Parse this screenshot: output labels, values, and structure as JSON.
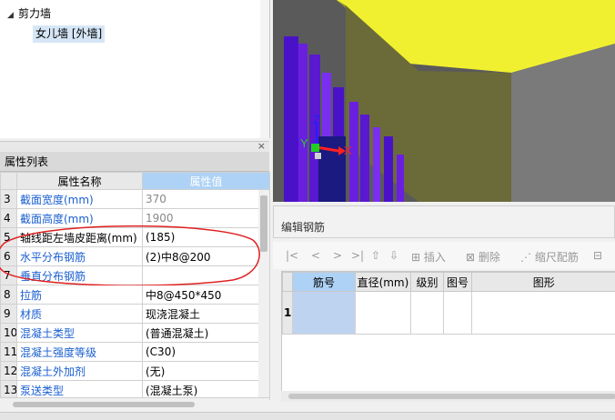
{
  "tree": {
    "group_label": "剪力墙",
    "item_label": "女儿墙 [外墙]"
  },
  "properties": {
    "panel_title": "属性列表",
    "col_name": "属性名称",
    "col_value": "属性值",
    "rows": [
      {
        "num": "3",
        "name": "截面宽度(mm)",
        "value": "370"
      },
      {
        "num": "4",
        "name": "截面高度(mm)",
        "value": "1900"
      },
      {
        "num": "5",
        "name": "轴线距左墙皮距离(mm)",
        "value": "(185)"
      },
      {
        "num": "6",
        "name": "水平分布钢筋",
        "value": "(2)中8@200"
      },
      {
        "num": "7",
        "name": "垂直分布钢筋",
        "value": ""
      },
      {
        "num": "8",
        "name": "拉筋",
        "value": "中8@450*450"
      },
      {
        "num": "9",
        "name": "材质",
        "value": "现浇混凝土"
      },
      {
        "num": "10",
        "name": "混凝土类型",
        "value": "(普通混凝土)"
      },
      {
        "num": "11",
        "name": "混凝土强度等级",
        "value": "(C30)"
      },
      {
        "num": "12",
        "name": "混凝土外加剂",
        "value": "(无)"
      },
      {
        "num": "13",
        "name": "泵送类型",
        "value": "(混凝土泵)"
      }
    ]
  },
  "viewport": {
    "axis_x": "X",
    "axis_y": "Y",
    "axis_z": "Z"
  },
  "rebar_editor": {
    "title": "编辑钢筋",
    "toolbar": {
      "first": "|<",
      "prev": "<",
      "next": ">",
      "last": ">|",
      "insert": "插入",
      "delete": "删除",
      "scale": "缩尺配筋"
    },
    "columns": [
      "筋号",
      "直径(mm)",
      "级别",
      "图号",
      "图形"
    ],
    "row_number": "1"
  },
  "colors": {
    "selection_blue": "#aed2f5",
    "link_blue": "#1a5fd0",
    "annotation_red": "#e02020",
    "wall_purple": "#6a1fe0",
    "slab_yellow": "#f0f030"
  }
}
